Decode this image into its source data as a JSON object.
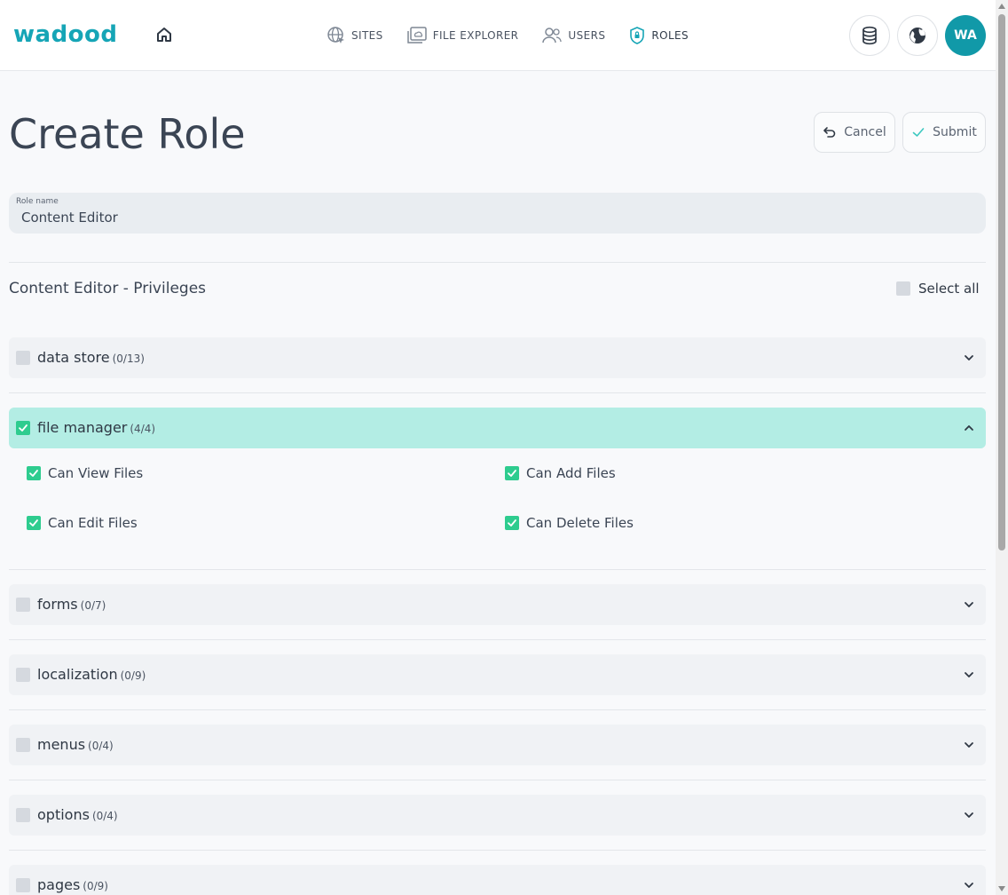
{
  "header": {
    "logo": "wadood",
    "nav": [
      {
        "label": "SITES",
        "icon": "globe-cursor-icon"
      },
      {
        "label": "FILE EXPLORER",
        "icon": "folder-cloud-icon"
      },
      {
        "label": "USERS",
        "icon": "users-icon"
      },
      {
        "label": "ROLES",
        "icon": "shield-lock-icon",
        "active": true
      }
    ],
    "avatar_initials": "WA"
  },
  "page": {
    "title": "Create Role",
    "cancel_label": "Cancel",
    "submit_label": "Submit"
  },
  "role_name": {
    "label": "Role name",
    "value": "Content Editor"
  },
  "privileges": {
    "title": "Content Editor - Privileges",
    "select_all_label": "Select all",
    "groups": [
      {
        "name": "data store",
        "count": "(0/13)",
        "checked": false,
        "expanded": false
      },
      {
        "name": "file manager",
        "count": "(4/4)",
        "checked": true,
        "expanded": true,
        "permissions": [
          {
            "label": "Can View Files",
            "checked": true
          },
          {
            "label": "Can Add Files",
            "checked": true
          },
          {
            "label": "Can Edit Files",
            "checked": true
          },
          {
            "label": "Can Delete Files",
            "checked": true
          }
        ]
      },
      {
        "name": "forms",
        "count": "(0/7)",
        "checked": false,
        "expanded": false
      },
      {
        "name": "localization",
        "count": "(0/9)",
        "checked": false,
        "expanded": false
      },
      {
        "name": "menus",
        "count": "(0/4)",
        "checked": false,
        "expanded": false
      },
      {
        "name": "options",
        "count": "(0/4)",
        "checked": false,
        "expanded": false
      },
      {
        "name": "pages",
        "count": "(0/9)",
        "checked": false,
        "expanded": false
      }
    ]
  },
  "colors": {
    "accent": "#16a5b6",
    "avatar": "#1199a8",
    "check": "#2ecc8f",
    "expanded_bg": "#b3ede4"
  }
}
